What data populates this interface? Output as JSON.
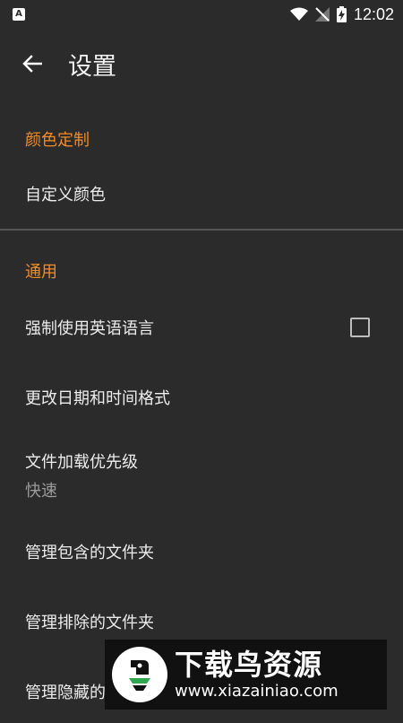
{
  "status_bar": {
    "time": "12:02",
    "notification_letter": "A"
  },
  "toolbar": {
    "title": "设置"
  },
  "sections": {
    "color": {
      "header": "颜色定制",
      "items": [
        {
          "label": "自定义颜色"
        }
      ]
    },
    "general": {
      "header": "通用",
      "items": [
        {
          "label": "强制使用英语语言",
          "checked": false
        },
        {
          "label": "更改日期和时间格式"
        },
        {
          "label": "文件加载优先级",
          "value": "快速"
        },
        {
          "label": "管理包含的文件夹"
        },
        {
          "label": "管理排除的文件夹"
        },
        {
          "label": "管理隐藏的"
        }
      ]
    }
  },
  "watermark": {
    "title": "下载鸟资源",
    "url": "www.xiazainiao.com"
  },
  "colors": {
    "background": "#2b2b2b",
    "accent": "#f28c28",
    "text": "#ececec",
    "secondary_text": "#9a9a9a"
  }
}
